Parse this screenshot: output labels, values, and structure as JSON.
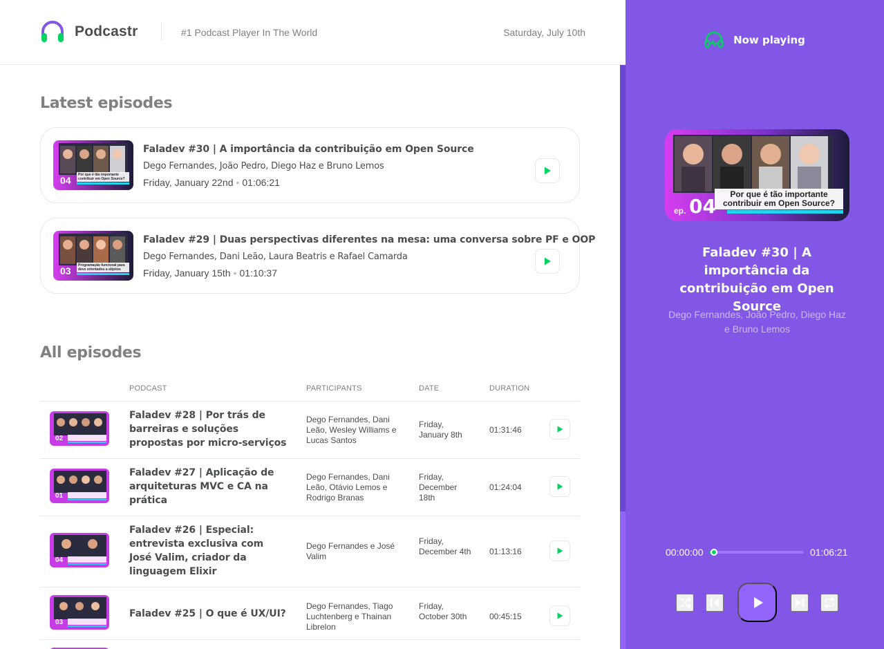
{
  "app": {
    "name": "Podcastr",
    "tagline": "#1 Podcast Player In The World",
    "date": "Saturday, July 10th"
  },
  "latest": {
    "title": "Latest episodes",
    "episodes": [
      {
        "title": "Faladev #30 | A importância da contribuição em Open Source",
        "members": "Dego Fernandes, João Pedro, Diego Haz e Bruno Lemos",
        "date": "Friday, January 22nd",
        "duration": "01:06:21",
        "thumb_number": "04",
        "thumb_caption": "Por que é tão importante contribuir em Open Source?"
      },
      {
        "title": "Faladev #29 | Duas perspectivas diferentes na mesa: uma conversa sobre PF e OOP",
        "members": "Dego Fernandes, Dani Leão, Laura Beatris e Rafael Camarda",
        "date": "Friday, January 15th",
        "duration": "01:10:37",
        "thumb_number": "03",
        "thumb_caption": "Programação funcional para devs orientados a objetos"
      }
    ]
  },
  "all": {
    "title": "All episodes",
    "columns": {
      "podcast": "Podcast",
      "participants": "Participants",
      "date": "Date",
      "duration": "Duration"
    },
    "rows": [
      {
        "title": "Faladev #28 | Por trás de barreiras e soluções propostas por micro-serviços",
        "members": "Dego Fernandes, Dani Leão, Wesley Williams e Lucas Santos",
        "date": "Friday, January 8th",
        "duration": "01:31:46",
        "thumb_number": "02",
        "thumb_caption": "Microsserviços na prática"
      },
      {
        "title": "Faladev #27 | Aplicação de arquiteturas MVC e CA na prática",
        "members": "Dego Fernandes, Dani Leão, Otávio Lemos e Rodrigo Branas",
        "date": "Friday, December 18th",
        "duration": "01:24:04",
        "thumb_number": "01",
        "thumb_caption": "MVC no Clean Architecture e DDD"
      },
      {
        "title": "Faladev #26 | Especial: entrevista exclusiva com José Valim, criador da linguagem Elixir",
        "members": "Dego Fernandes e José Valim",
        "date": "Friday, December 4th",
        "duration": "01:13:16",
        "thumb_number": "04",
        "thumb_caption": "Especial: José Valim, criador do Elixir"
      },
      {
        "title": "Faladev #25 | O que é UX/UI?",
        "members": "Dego Fernandes, Tiago Luchtenberg e Thainan Librelon",
        "date": "Friday, October 30th",
        "duration": "00:45:15",
        "thumb_number": "03",
        "thumb_caption": "O que é UX/UI?"
      }
    ]
  },
  "player": {
    "label": "Now playing",
    "title": "Faladev #30 | A importância da contribuição em Open Source",
    "members": "Dego Fernandes, João Pedro, Diego Haz e Bruno Lemos",
    "cover_prefix": "ep.",
    "cover_number": "04",
    "cover_caption": "Por que é tão importante contribuir em Open Source?",
    "current_time": "00:00:00",
    "total_time": "01:06:21",
    "progress": 0.05
  },
  "colors": {
    "brand_purple": "#8257e5",
    "accent_green": "#04d361",
    "text_gray": "#494d4b",
    "muted_gray": "#808080"
  },
  "icons": {
    "logo": "headphones-icon",
    "now_playing": "headphones-icon",
    "play": "play-icon",
    "shuffle": "shuffle-icon",
    "previous": "skip-previous-icon",
    "next": "skip-next-icon",
    "repeat": "repeat-icon"
  }
}
